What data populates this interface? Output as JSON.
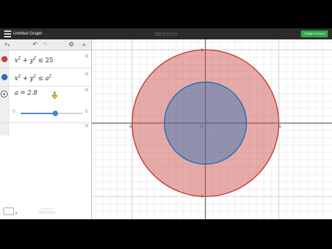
{
  "topbar": {
    "graph_title": "Untitled Graph",
    "brand": "desmos",
    "create_account_label": "Create Account"
  },
  "expression_toolbar": {
    "add_icon": "plus-icon",
    "undo_icon": "undo-icon",
    "settings_icon": "gear-icon",
    "collapse_icon": "double-chevron-left-icon"
  },
  "expressions": [
    {
      "base": "x",
      "exp": "2",
      "op": "+",
      "base2": "y",
      "exp2": "2",
      "rel": "≤",
      "rhs": "25",
      "rhs_exp": "",
      "color": "#c74440"
    },
    {
      "base": "x",
      "exp": "2",
      "op": "+",
      "base2": "y",
      "exp2": "2",
      "rel": "≤",
      "rhs": "a",
      "rhs_exp": "2",
      "color": "#2d70b3"
    }
  ],
  "slider": {
    "label": "a = 2.8",
    "min": "0",
    "max": "5",
    "value": 2.8
  },
  "footer": {
    "keyboard_icon": "keyboard-icon",
    "powered_by": "powered by",
    "powered_brand": "desmos"
  },
  "graph": {
    "x_labels": [
      "-5",
      "0",
      "5"
    ],
    "y_labels": [
      "5",
      "-5"
    ],
    "outer_radius": 5,
    "inner_radius": 2.8,
    "outer_color": "#c74440",
    "inner_color": "#2d70b3"
  }
}
